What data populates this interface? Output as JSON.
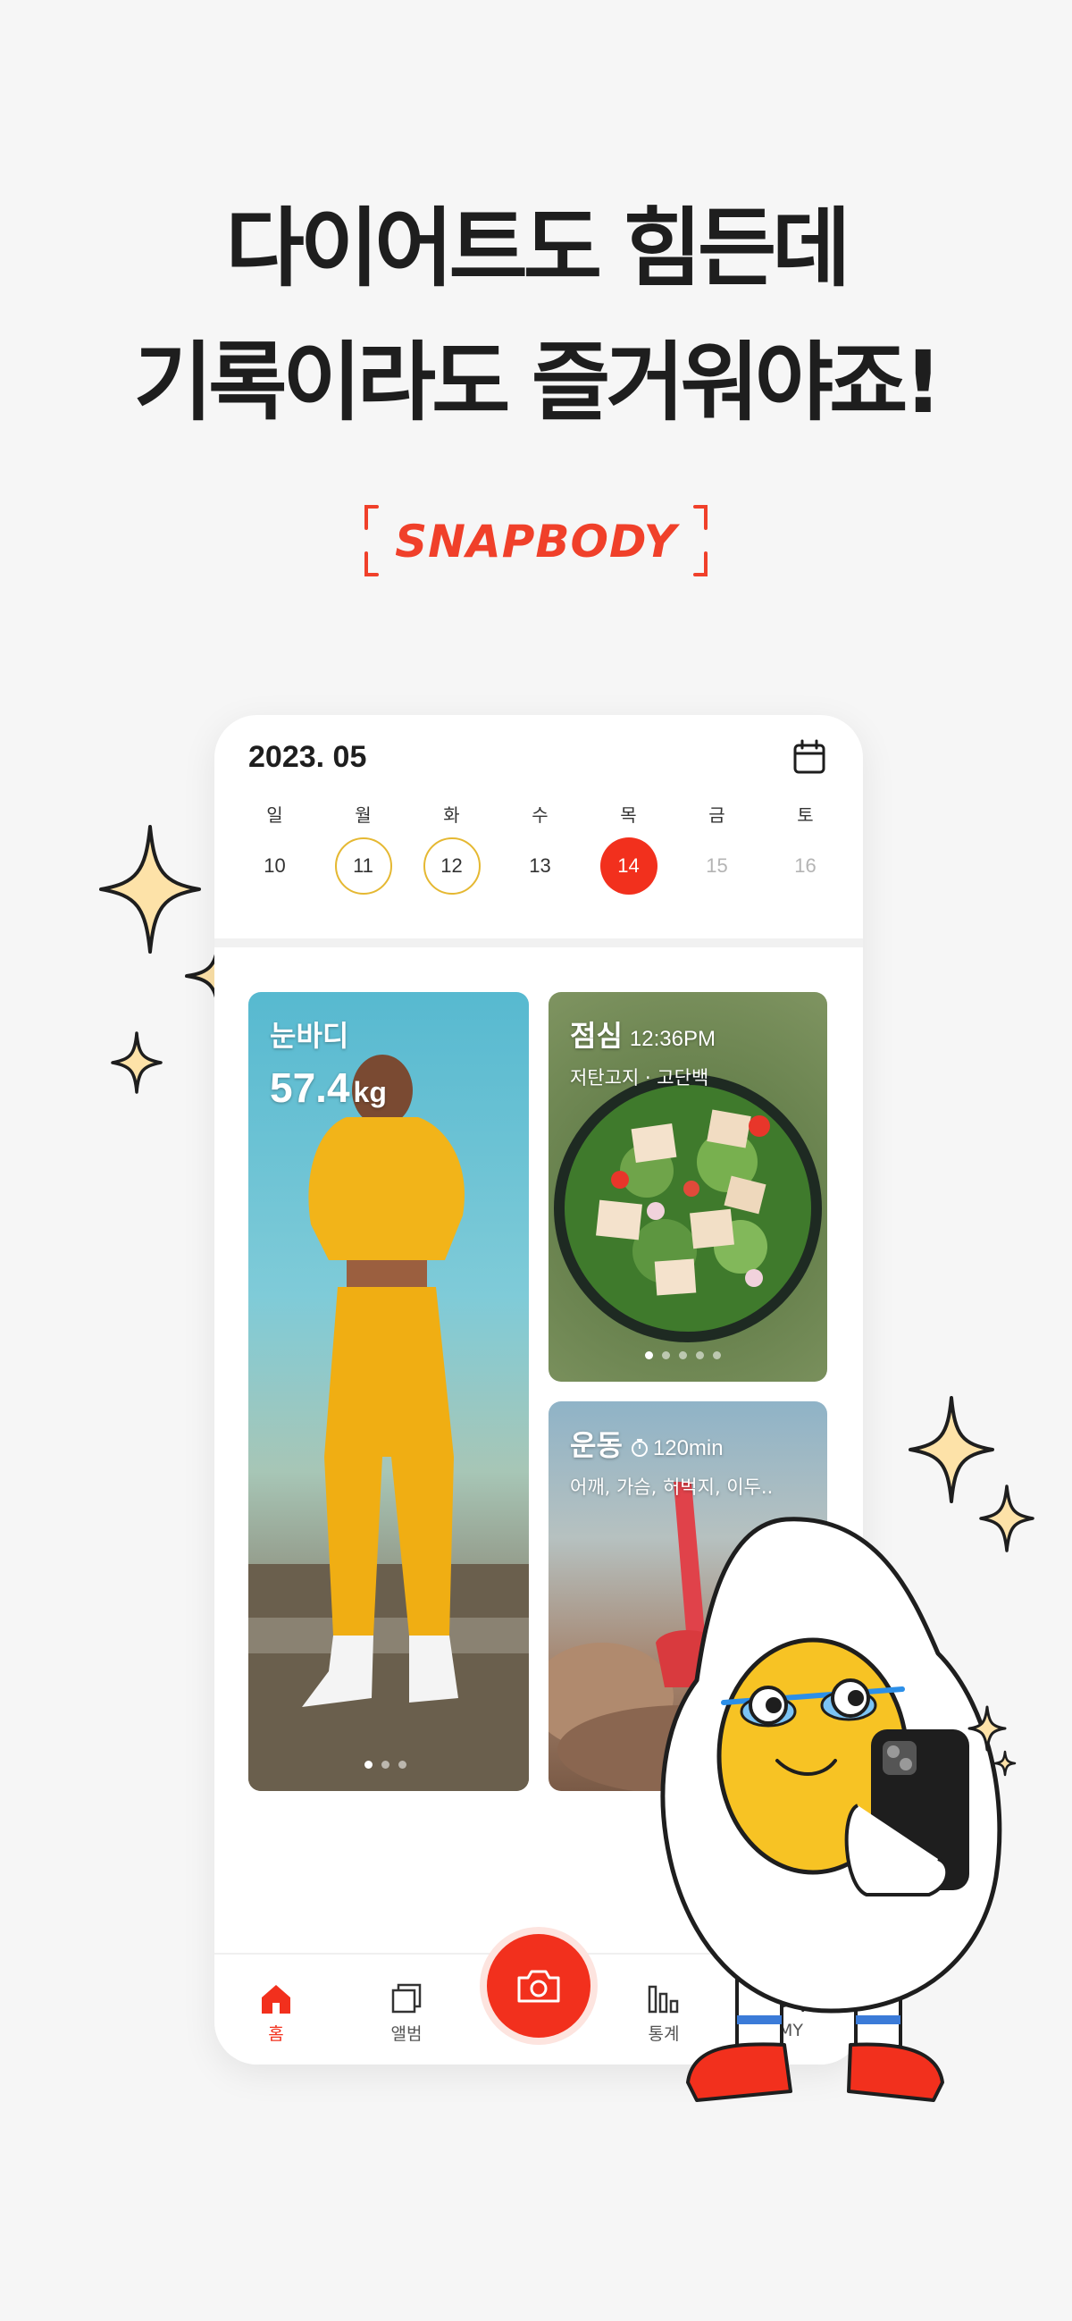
{
  "headline": {
    "line1": "다이어트도 힘든데",
    "line2": "기록이라도 즐거워야죠!"
  },
  "brand": {
    "logo_text": "SNAPBODY"
  },
  "calendar": {
    "month_label": "2023. 05",
    "weekdays": [
      "일",
      "월",
      "화",
      "수",
      "목",
      "금",
      "토"
    ],
    "dates": [
      "10",
      "11",
      "12",
      "13",
      "14",
      "15",
      "16"
    ],
    "selected_date": "14",
    "recorded_dates": [
      "11",
      "12"
    ]
  },
  "cards": {
    "body": {
      "title": "눈바디",
      "weight_value": "57.4",
      "weight_unit": "kg"
    },
    "lunch": {
      "title": "점심",
      "time": "12:36PM",
      "tags": "저탄고지 · 고단백"
    },
    "workout": {
      "title": "운동",
      "duration": "120min",
      "parts": "어깨, 가슴, 허벅지, 이두.."
    }
  },
  "nav": {
    "home": "홈",
    "album": "앨범",
    "stats": "통계",
    "my": "MY"
  },
  "colors": {
    "accent": "#f2301d",
    "ring": "#e5b832",
    "sparkle": "#fde2a8",
    "background": "#f6f6f6"
  }
}
